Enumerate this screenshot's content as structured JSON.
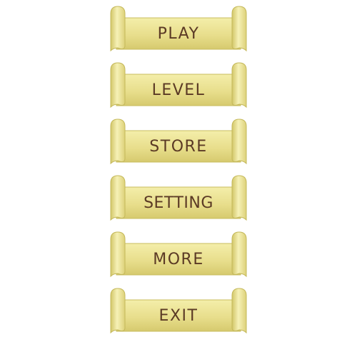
{
  "menu": {
    "items": [
      {
        "label": "PLAY"
      },
      {
        "label": "LEVEL"
      },
      {
        "label": "STORE"
      },
      {
        "label": "SETTING"
      },
      {
        "label": "MORE"
      },
      {
        "label": "EXIT"
      }
    ]
  },
  "colors": {
    "button_light": "#f3eda6",
    "button_mid": "#e6db86",
    "button_dark": "#cbbf63",
    "label_text": "#5b3a25"
  }
}
